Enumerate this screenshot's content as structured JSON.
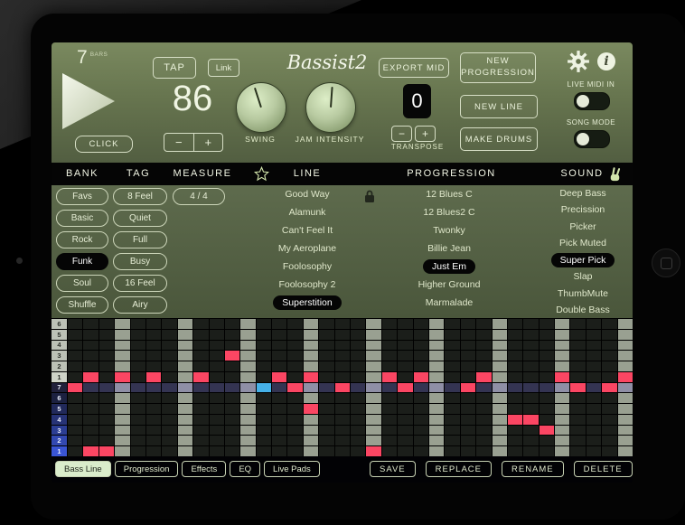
{
  "transport": {
    "bars_value": "7",
    "bars_unit": "BARS",
    "tap": "TAP",
    "link": "Link",
    "logo": "Bassist2",
    "export_mid": "EXPORT MID",
    "new_progression": "NEW PROGRESSION",
    "tempo": "86",
    "minus": "−",
    "plus": "+",
    "click": "CLICK",
    "swing_label": "SWING",
    "swing_angle": -18,
    "jam_label": "JAM INTENSITY",
    "jam_angle": 4,
    "transpose_value": "0",
    "transpose_label": "TRANSPOSE",
    "new_line": "NEW LINE",
    "make_drums": "MAKE DRUMS",
    "live_midi": "LIVE MIDI IN",
    "song_mode": "SONG MODE",
    "info_glyph": "i"
  },
  "header": {
    "bank": "BANK",
    "tag": "TAG",
    "measure": "MEASURE",
    "line": "LINE",
    "progression": "PROGRESSION",
    "sound": "SOUND"
  },
  "browser": {
    "measure_value": "4 / 4",
    "bank_items": [
      {
        "label": "Favs"
      },
      {
        "label": "Basic"
      },
      {
        "label": "Rock"
      },
      {
        "label": "Funk",
        "selected": true
      },
      {
        "label": "Soul"
      },
      {
        "label": "Shuffle"
      }
    ],
    "tag_items": [
      {
        "label": "8 Feel"
      },
      {
        "label": "Quiet"
      },
      {
        "label": "Full"
      },
      {
        "label": "Busy"
      },
      {
        "label": "16 Feel"
      },
      {
        "label": "Airy"
      }
    ],
    "line_items": [
      {
        "label": "Good Way"
      },
      {
        "label": "Alamunk"
      },
      {
        "label": "Can't Feel It"
      },
      {
        "label": "My Aeroplane"
      },
      {
        "label": "Foolosophy"
      },
      {
        "label": "Foolosophy 2"
      },
      {
        "label": "Superstition",
        "selected": true
      }
    ],
    "progression_items": [
      {
        "label": "12 Blues C"
      },
      {
        "label": "12 Blues2 C"
      },
      {
        "label": "Twonky"
      },
      {
        "label": "Billie Jean"
      },
      {
        "label": "Just Em",
        "selected": true
      },
      {
        "label": "Higher Ground"
      },
      {
        "label": "Marmalade"
      }
    ],
    "sound_items": [
      {
        "label": "Deep Bass"
      },
      {
        "label": "Precission"
      },
      {
        "label": "Picker"
      },
      {
        "label": "Pick Muted"
      },
      {
        "label": "Super Pick",
        "selected": true
      },
      {
        "label": "Slap"
      },
      {
        "label": "ThumbMute"
      },
      {
        "label": "Double Bass"
      }
    ]
  },
  "sequencer": {
    "cols": 36,
    "row_labels": [
      "6",
      "5",
      "4",
      "3",
      "2",
      "1",
      "7",
      "6",
      "5",
      "4",
      "3",
      "2",
      "1"
    ],
    "label_colors": [
      "#bcc1b6",
      "#bcc1b6",
      "#bcc1b6",
      "#bcc1b6",
      "#bcc1b6",
      "#ced3c7",
      "#20203a",
      "#1c2140",
      "#21295a",
      "#273376",
      "#2c3e94",
      "#3349b2",
      "#3a55d4"
    ],
    "highlight_row": 6,
    "notes": [
      {
        "r": 3,
        "c": 10
      },
      {
        "r": 5,
        "c": 1
      },
      {
        "r": 5,
        "c": 3
      },
      {
        "r": 5,
        "c": 5
      },
      {
        "r": 5,
        "c": 8
      },
      {
        "r": 5,
        "c": 13
      },
      {
        "r": 5,
        "c": 15
      },
      {
        "r": 5,
        "c": 20
      },
      {
        "r": 5,
        "c": 22
      },
      {
        "r": 5,
        "c": 26
      },
      {
        "r": 5,
        "c": 31
      },
      {
        "r": 5,
        "c": 35
      },
      {
        "r": 6,
        "c": 0
      },
      {
        "r": 6,
        "c": 14
      },
      {
        "r": 6,
        "c": 17
      },
      {
        "r": 6,
        "c": 21
      },
      {
        "r": 6,
        "c": 25
      },
      {
        "r": 6,
        "c": 32
      },
      {
        "r": 6,
        "c": 34
      },
      {
        "r": 8,
        "c": 15
      },
      {
        "r": 9,
        "c": 28
      },
      {
        "r": 9,
        "c": 29
      },
      {
        "r": 10,
        "c": 30
      },
      {
        "r": 12,
        "c": 1
      },
      {
        "r": 12,
        "c": 2
      },
      {
        "r": 12,
        "c": 19
      }
    ],
    "cursor": {
      "r": 6,
      "c": 12
    },
    "colors": {
      "note": "#fb4663",
      "cursor": "#45b1e8",
      "cell": "#1b1e1a",
      "beat": "#99a091",
      "row_hl": "#343452",
      "beat_hl": "#8f8fa6"
    }
  },
  "footer": {
    "tabs": [
      {
        "label": "Bass Line",
        "selected": true
      },
      {
        "label": "Progression"
      },
      {
        "label": "Effects"
      },
      {
        "label": "EQ"
      },
      {
        "label": "Live Pads"
      }
    ],
    "buttons": [
      {
        "label": "SAVE"
      },
      {
        "label": "REPLACE"
      },
      {
        "label": "RENAME"
      },
      {
        "label": "DELETE"
      }
    ]
  }
}
